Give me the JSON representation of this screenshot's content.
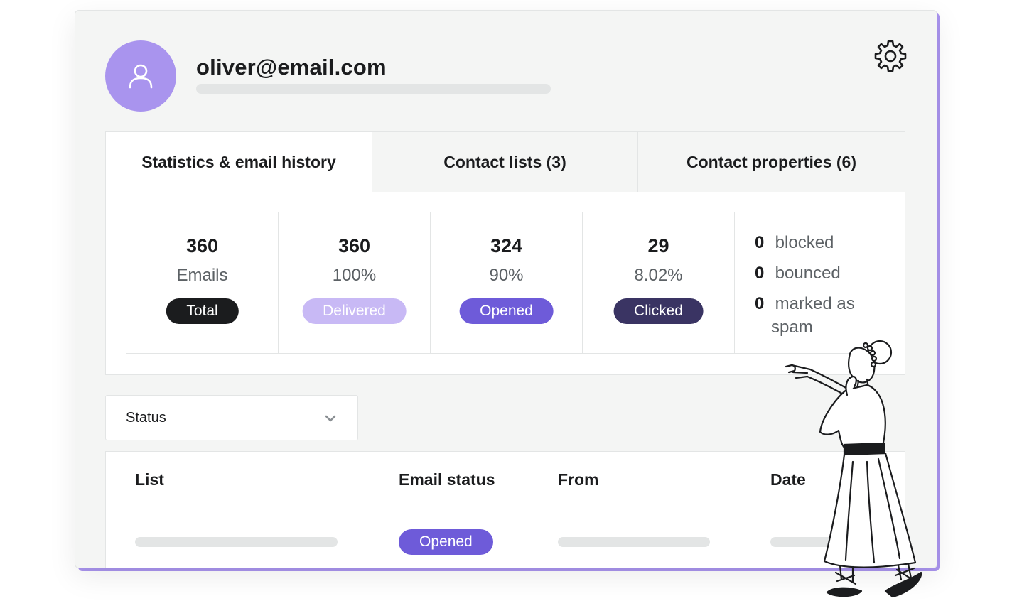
{
  "contact": {
    "email": "oliver@email.com"
  },
  "tabs": [
    {
      "label": "Statistics & email history",
      "active": true
    },
    {
      "label": "Contact lists (3)",
      "active": false
    },
    {
      "label": "Contact properties (6)",
      "active": false
    }
  ],
  "stats": [
    {
      "value": "360",
      "label": "Emails",
      "pill": "Total"
    },
    {
      "value": "360",
      "label": "100%",
      "pill": "Delivered"
    },
    {
      "value": "324",
      "label": "90%",
      "pill": "Opened"
    },
    {
      "value": "29",
      "label": "8.02%",
      "pill": "Clicked"
    }
  ],
  "negatives": [
    {
      "count": "0",
      "label": "blocked"
    },
    {
      "count": "0",
      "label": "bounced"
    },
    {
      "count": "0",
      "label": "marked as"
    }
  ],
  "negatives_continuation": "spam",
  "filter": {
    "label": "Status"
  },
  "table": {
    "headers": [
      "List",
      "Email status",
      "From",
      "Date"
    ],
    "rows": [
      {
        "status": "Opened"
      }
    ]
  },
  "colors": {
    "accent": "#a994ee",
    "opened": "#6e5bd9",
    "delivered": "#c8b9f5",
    "clicked": "#3a3463",
    "total": "#1b1c1e"
  },
  "icons": {
    "avatar": "user-icon",
    "settings": "gear-icon",
    "dropdown": "chevron-down-icon"
  }
}
